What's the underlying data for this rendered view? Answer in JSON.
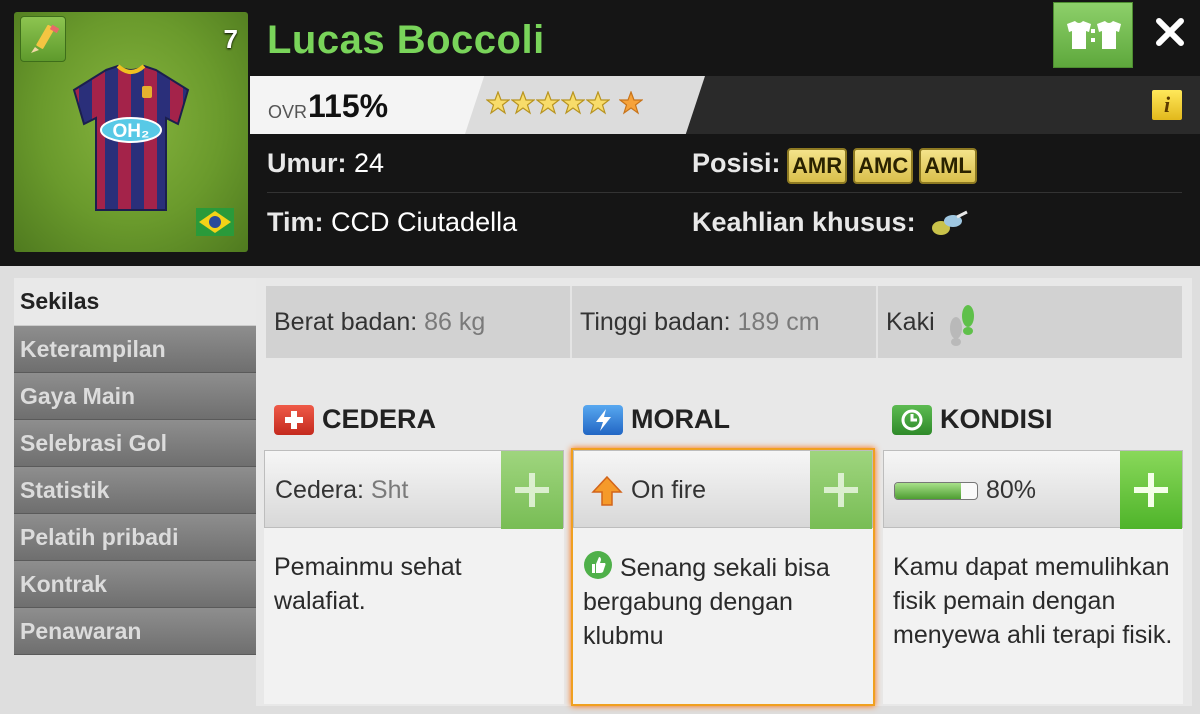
{
  "player": {
    "name": "Lucas Boccoli",
    "jersey_number": "7",
    "sponsor": "OH₂",
    "ovr_label": "OVR",
    "ovr_value": "115%",
    "stars": 6,
    "info_glyph": "i"
  },
  "details": {
    "age_label": "Umur:",
    "age_value": "24",
    "team_label": "Tim:",
    "team_value": "CCD Ciutadella",
    "position_label": "Posisi:",
    "positions": [
      "AMR",
      "AMC",
      "AML"
    ],
    "special_label": "Keahlian khusus:"
  },
  "sidebar": {
    "items": [
      {
        "label": "Sekilas",
        "active": true
      },
      {
        "label": "Keterampilan",
        "active": false
      },
      {
        "label": "Gaya Main",
        "active": false
      },
      {
        "label": "Selebrasi Gol",
        "active": false
      },
      {
        "label": "Statistik",
        "active": false
      },
      {
        "label": "Pelatih pribadi",
        "active": false
      },
      {
        "label": "Kontrak",
        "active": false
      },
      {
        "label": "Penawaran",
        "active": false
      }
    ]
  },
  "stats": {
    "weight_label": "Berat badan:",
    "weight_value": "86 kg",
    "height_label": "Tinggi badan:",
    "height_value": "189 cm",
    "foot_label": "Kaki"
  },
  "sections": {
    "injury": {
      "title": "CEDERA",
      "status_label": "Cedera:",
      "status_value": "Sht",
      "description": "Pemainmu sehat walafiat."
    },
    "morale": {
      "title": "MORAL",
      "status_value": "On fire",
      "description": "Senang sekali bisa bergabung dengan klubmu"
    },
    "condition": {
      "title": "KONDISI",
      "percent_text": "80%",
      "level": 0.8,
      "description": "Kamu dapat memulihkan fisik pemain dengan menyewa ahli terapi fisik."
    }
  },
  "colors": {
    "name_green": "#79d45a",
    "accent_green": "#5ea83c",
    "badge_gold": "#d9bf4b",
    "injury_red": "#d83a2c",
    "morale_blue": "#2f7fd8",
    "condition_green": "#3f9a36"
  },
  "icons": {
    "edit": "pencil-icon",
    "kit": "kit-swap-icon",
    "close": "close-icon",
    "info": "info-icon",
    "flag": "brazil-flag-icon",
    "special": "special-skill-icon",
    "foot": "feet-icon",
    "injury": "medical-cross-icon",
    "morale": "lightning-icon",
    "condition": "clock-icon",
    "morale_arrow": "up-arrow-icon",
    "thumbs": "thumbs-up-icon"
  }
}
